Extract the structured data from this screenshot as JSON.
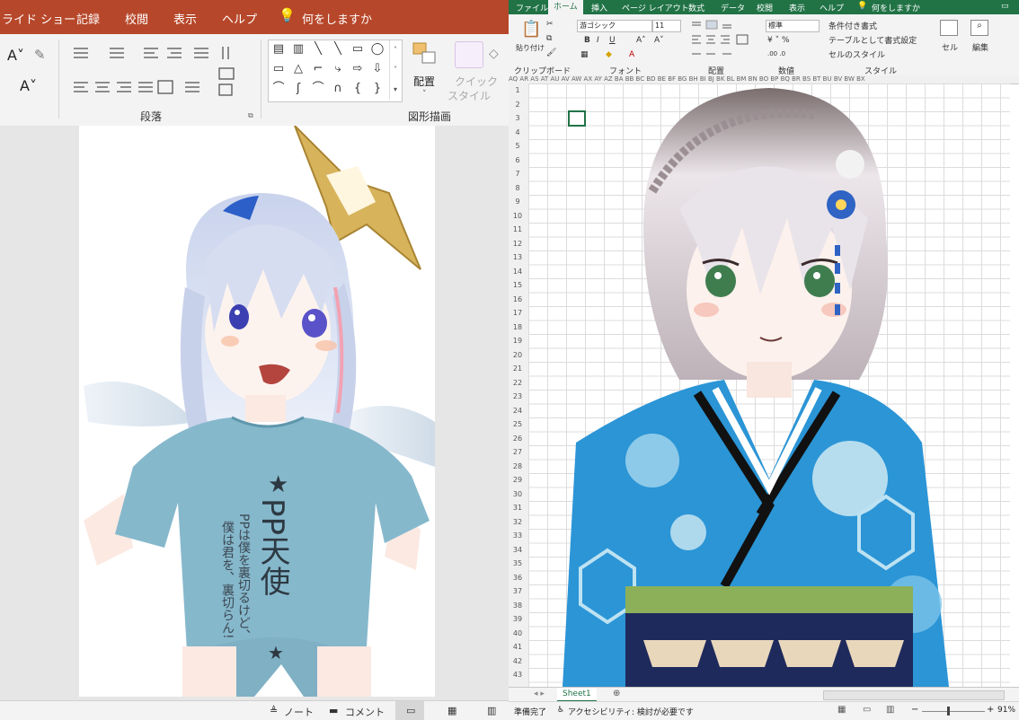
{
  "powerpoint": {
    "tabs": [
      "ライド ショー",
      "記録",
      "校閲",
      "表示",
      "ヘルプ",
      "何をしますか"
    ],
    "groups": {
      "paragraph": "段落",
      "drawing": "図形描画"
    },
    "buttons": {
      "arrange": "配置",
      "quick_style_1": "クイック",
      "quick_style_2": "スタイル"
    },
    "shapes": [
      "▤",
      "▥",
      "╲",
      "╲",
      "▭",
      "◯",
      "▭",
      "△",
      "⌐",
      "⤷",
      "⇨",
      "⇩",
      "⌒",
      "ʃ",
      "⌒",
      "∩",
      "{",
      "}"
    ],
    "status": {
      "notes": "ノート",
      "comments": "コメント"
    },
    "slide": {
      "shirt_star": "★",
      "shirt_title": "PP天使",
      "shirt_line1": "PPは僕を裏切るけど、",
      "shirt_line2": "僕は君を、裏切らん!",
      "shirt_bottom_star": "★"
    }
  },
  "excel": {
    "tabs": [
      "ファイル",
      "ホーム",
      "挿入",
      "ページ レイアウト",
      "数式",
      "データ",
      "校閲",
      "表示",
      "ヘルプ",
      "何をしますか"
    ],
    "active_tab": "ホーム",
    "ribbon": {
      "paste": "貼り付け",
      "font_name": "游ゴシック",
      "font_size": "11",
      "number_format": "標準",
      "conditional_format": "条件付き書式",
      "table_format": "テーブルとして書式設定",
      "cell_styles": "セルのスタイル",
      "cells": "セル",
      "edit": "編集",
      "bold": "B",
      "italic": "I",
      "underline": "U"
    },
    "groups": {
      "clipboard": "クリップボード",
      "font": "フォント",
      "alignment": "配置",
      "number": "数値",
      "styles": "スタイル"
    },
    "col_headers": "AQ AR AS AT AU AV AW AX AY AZ BA BB BC BD BE BF BG BH BI BJ BK BL BM BN BO BP BQ BR BS BT BU BV BW BX",
    "rows": [
      "1",
      "2",
      "3",
      "4",
      "5",
      "6",
      "7",
      "8",
      "9",
      "10",
      "11",
      "12",
      "13",
      "14",
      "15",
      "16",
      "17",
      "18",
      "19",
      "20",
      "21",
      "22",
      "23",
      "24",
      "25",
      "26",
      "27",
      "28",
      "29",
      "30",
      "31",
      "32",
      "33",
      "34",
      "35",
      "36",
      "37",
      "38",
      "39",
      "40",
      "41",
      "42",
      "43"
    ],
    "sheet_tab": "Sheet1",
    "status": {
      "ready": "準備完了",
      "accessibility": "アクセシビリティ: 検討が必要です",
      "zoom": "91%"
    }
  },
  "colors": {
    "ppt_accent": "#b7472a",
    "excel_accent": "#217346",
    "shirt": "#86b8cc",
    "kimono": "#2b95d6"
  }
}
